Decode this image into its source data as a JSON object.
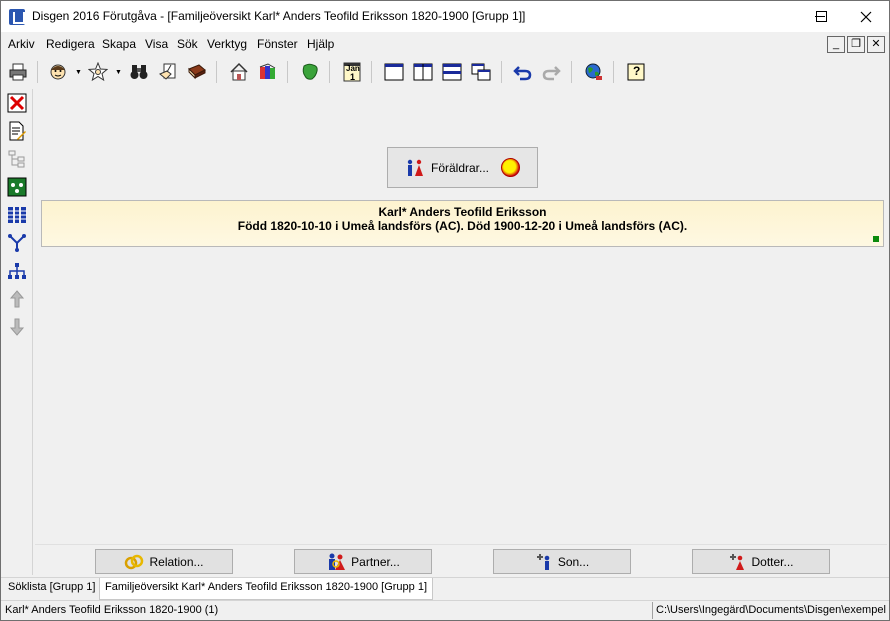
{
  "window": {
    "title": "Disgen 2016 Förutgåva - [Familjeöversikt Karl* Anders Teofild Eriksson 1820-1900 [Grupp 1]]",
    "minimize": "—",
    "maximize": "☐",
    "close": "✕"
  },
  "menu": {
    "items": [
      "Arkiv",
      "Redigera",
      "Skapa",
      "Visa",
      "Sök",
      "Verktyg",
      "Fönster",
      "Hjälp"
    ],
    "mdi": {
      "minimize": "_",
      "restore": "❐",
      "close": "✕"
    }
  },
  "toolbar": {
    "calendar_label": "Jan",
    "calendar_day": "1",
    "help_label": "?",
    "icons": [
      "printer-icon",
      "person-icon",
      "star-person-icon",
      "binoculars-icon",
      "edit-hand-icon",
      "book-icon",
      "home-icon",
      "books-icon",
      "map-icon",
      "calendar-icon",
      "window-single-icon",
      "window-split-vertical-icon",
      "window-split-horizontal-icon",
      "window-cascade-icon",
      "undo-icon",
      "redo-icon",
      "globe-icon",
      "help-icon"
    ]
  },
  "left_toolbar": {
    "icons": [
      "close-window-icon",
      "document-edit-icon",
      "tree-structure-icon",
      "family-tree-icon",
      "grid-tree-icon",
      "descendant-tree-icon",
      "org-chart-icon",
      "ancestor-up-icon",
      "ancestor-down-icon"
    ]
  },
  "main": {
    "parents_button": "Föräldrar...",
    "person": {
      "name": "Karl* Anders Teofild Eriksson",
      "details": "Född 1820-10-10 i Umeå landsförs (AC). Död 1900-12-20 i Umeå landsförs (AC)."
    }
  },
  "bottom_buttons": {
    "relation": "Relation...",
    "partner": "Partner...",
    "son": "Son...",
    "daughter": "Dotter..."
  },
  "tabs": [
    "Söklista [Grupp 1]",
    "Familjeöversikt Karl* Anders Teofild Eriksson 1820-1900 [Grupp 1]"
  ],
  "status": {
    "left": "Karl* Anders Teofild Eriksson 1820-1900 (1)",
    "right": "C:\\Users\\Ingegärd\\Documents\\Disgen\\exempel"
  }
}
